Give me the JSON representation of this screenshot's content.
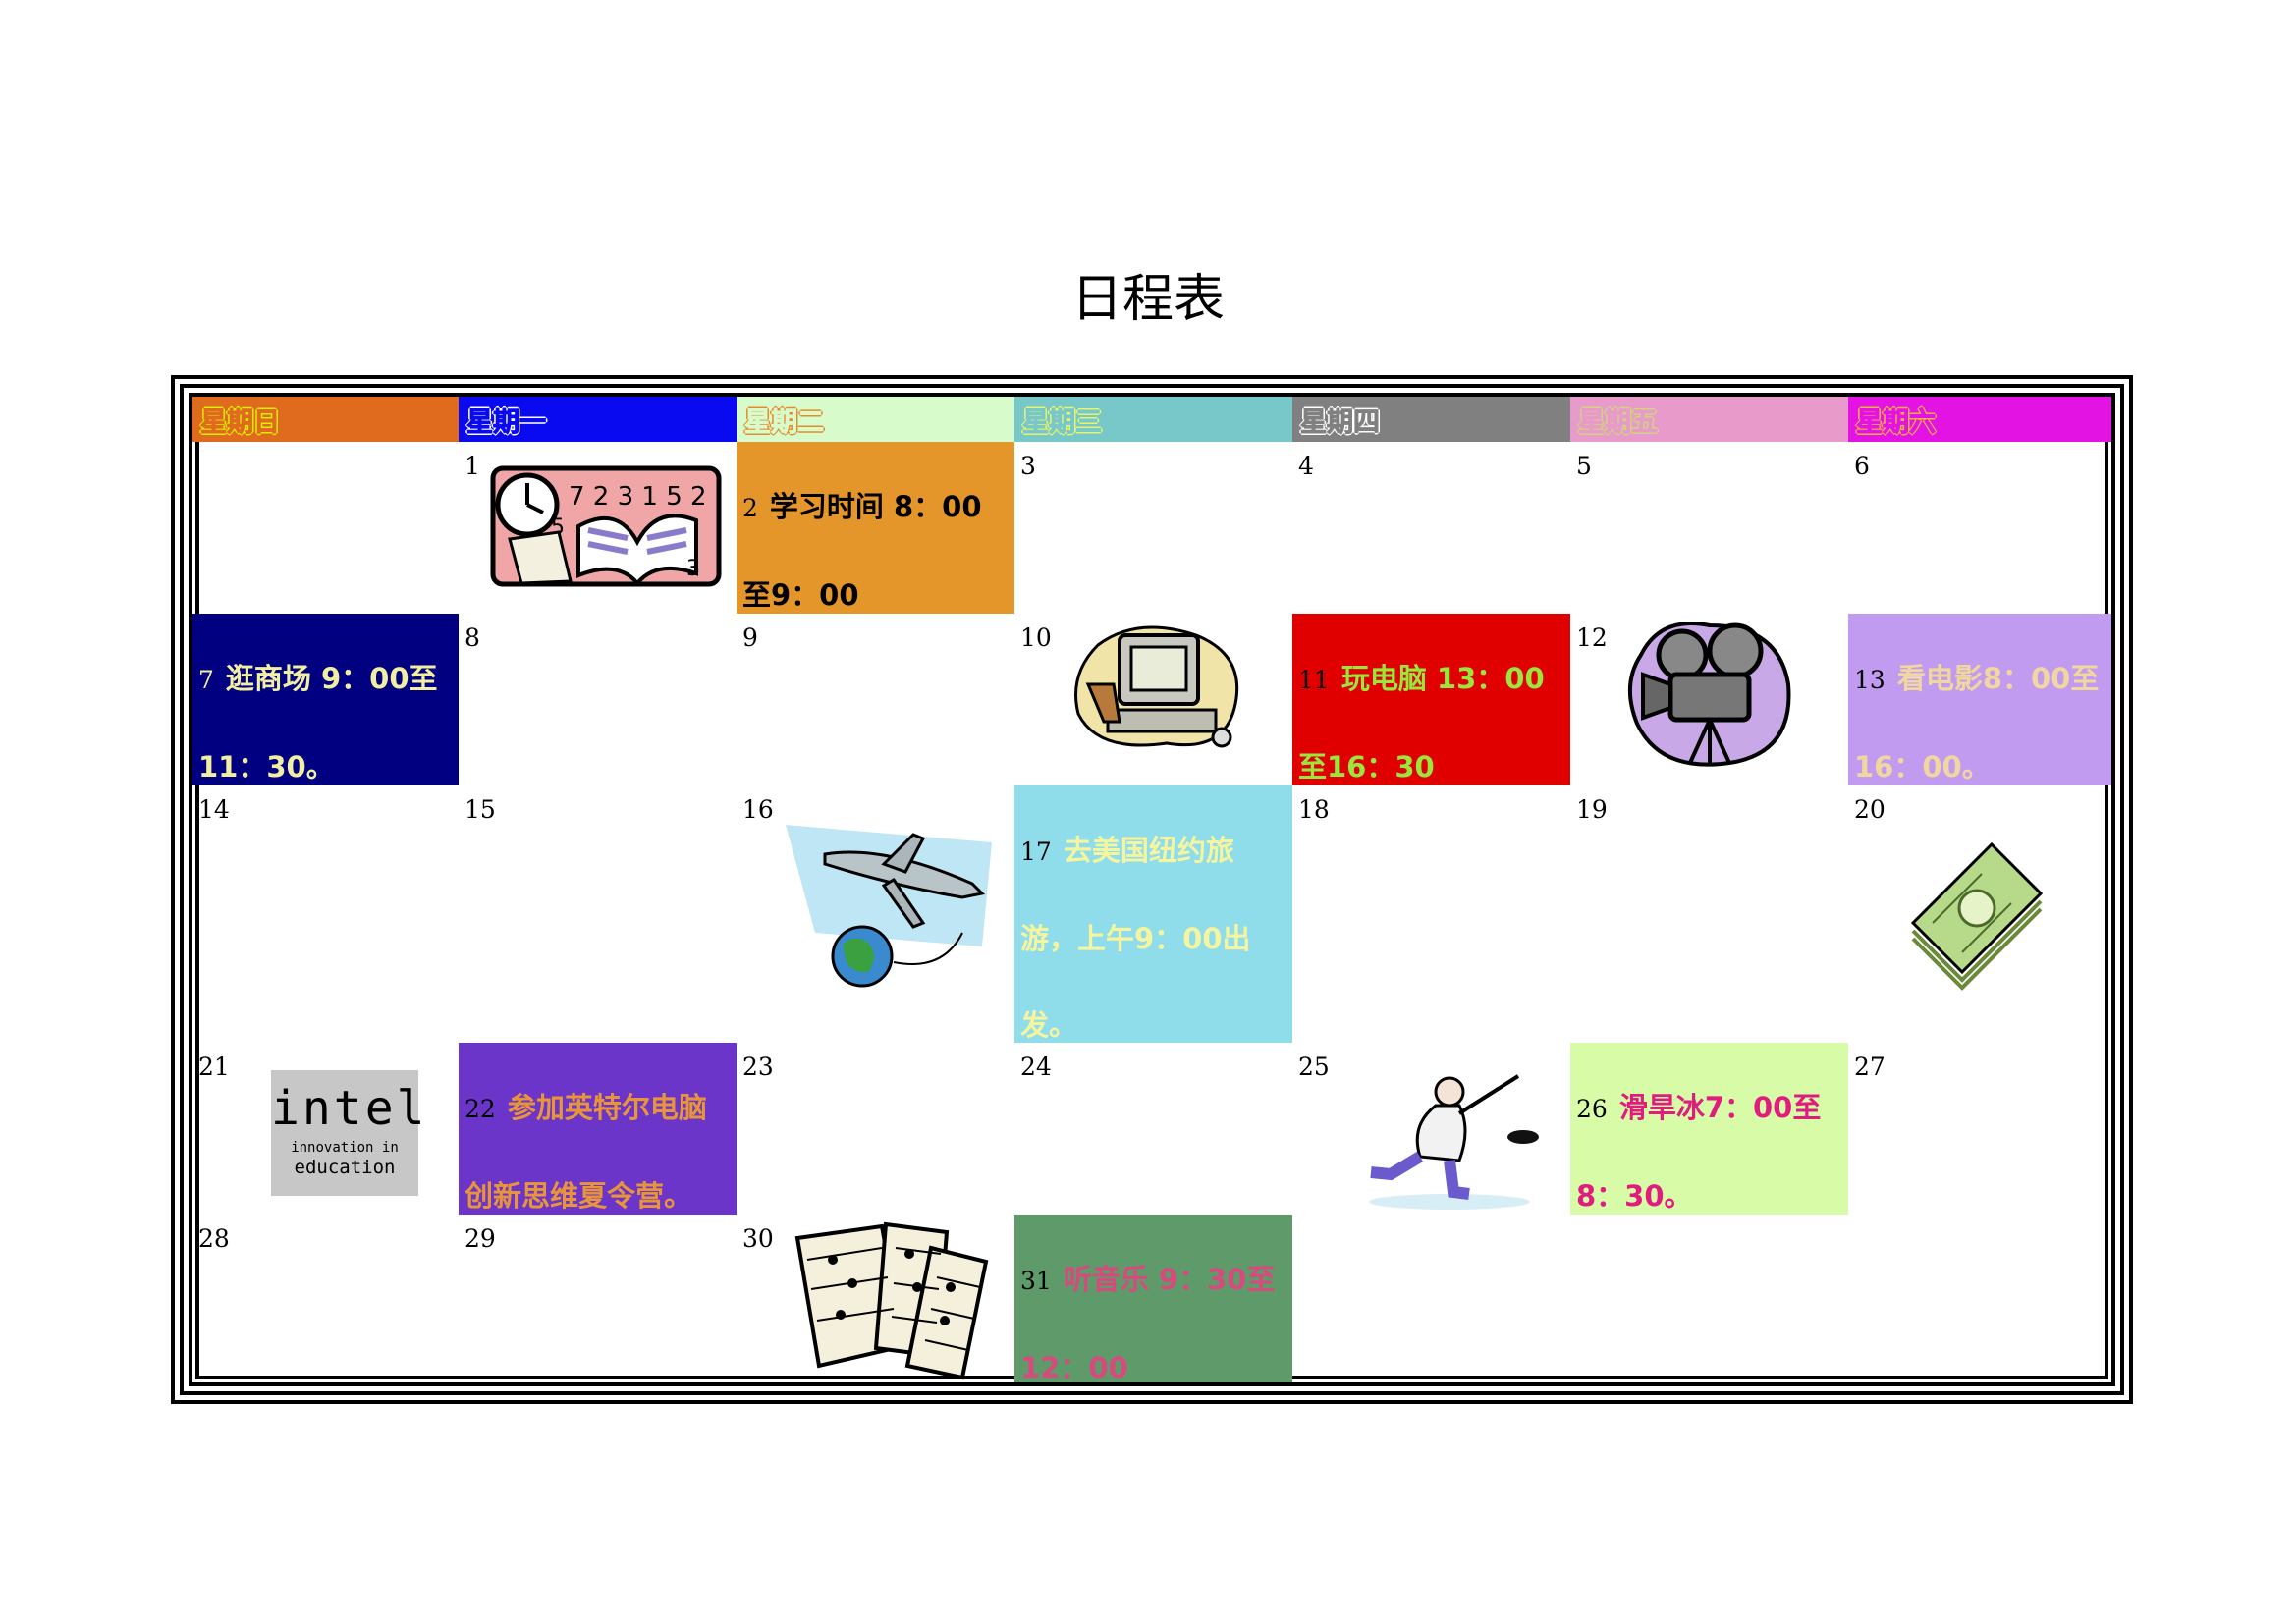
{
  "title": "日程表",
  "colors": {
    "sun": "#E06A1E",
    "mon": "#0A0AF0",
    "tue": "#D8FBCB",
    "wed": "#79C8C9",
    "thu": "#808080",
    "fri": "#E89ACB",
    "sat": "#E314E3"
  },
  "weekdays": [
    "星期日",
    "星期一",
    "星期二",
    "星期三",
    "星期四",
    "星期五",
    "星期六"
  ],
  "days": [
    "1",
    "2",
    "3",
    "4",
    "5",
    "6",
    "7",
    "8",
    "9",
    "10",
    "11",
    "12",
    "13",
    "14",
    "15",
    "16",
    "17",
    "18",
    "19",
    "20",
    "21",
    "22",
    "23",
    "24",
    "25",
    "26",
    "27",
    "28",
    "29",
    "30",
    "31"
  ],
  "events": {
    "d2": "学习时间 8：00至9：00",
    "d7": "逛商场 9：00至11：30。",
    "d11": "玩电脑 13：00至16：30",
    "d13": "看电影8：00至16：00。",
    "d17": "去美国纽约旅游，上午9：00出发。",
    "d22": "参加英特尔电脑创新思维夏令营。",
    "d26": "滑旱冰7：00至8：30。",
    "d31": "听音乐 9：30至12：00"
  },
  "intel_logo": {
    "brand": "intel",
    "tagline_1": "innovation in",
    "tagline_2": "education"
  },
  "clipart": [
    "clock-books-icon",
    "computer-icon",
    "movie-camera-icon",
    "airplane-globe-icon",
    "money-stack-icon",
    "intel-logo",
    "hockey-player-icon",
    "sheet-music-icon"
  ]
}
